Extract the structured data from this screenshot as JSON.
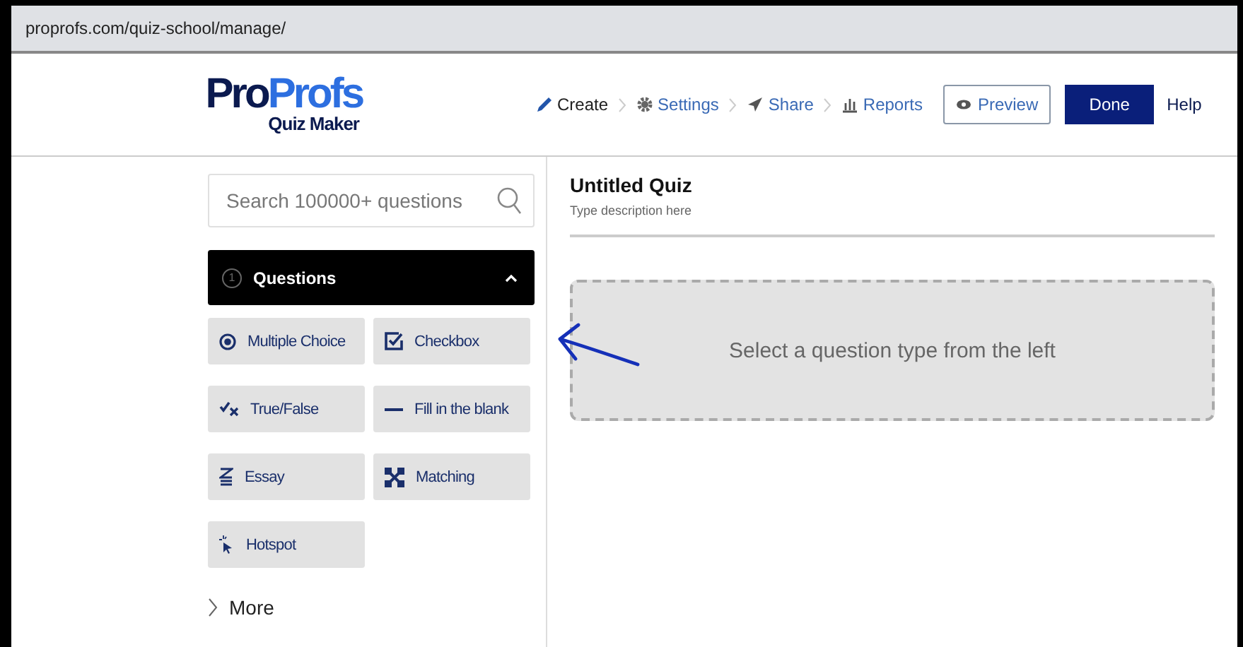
{
  "address_bar": {
    "url": "proprofs.com/quiz-school/manage/"
  },
  "header": {
    "logo": {
      "brand_dark": "Pro",
      "brand_blue": "Profs",
      "product": "Quiz Maker"
    },
    "steps": [
      {
        "kind": "pencil",
        "label": "Create"
      },
      {
        "kind": "gear",
        "label": "Settings"
      },
      {
        "kind": "plane",
        "label": "Share"
      },
      {
        "kind": "bars",
        "label": "Reports"
      }
    ],
    "preview_button": "Preview",
    "done_button": "Done",
    "help_link": "Help"
  },
  "sidebar": {
    "search": {
      "placeholder": "Search 100000+ questions"
    },
    "section": {
      "number": "1",
      "title": "Questions",
      "expanded": true
    },
    "question_types": [
      {
        "kind": "radio",
        "label": "Multiple Choice"
      },
      {
        "kind": "checkbox",
        "label": "Checkbox"
      },
      {
        "kind": "truefalse",
        "label": "True/False"
      },
      {
        "kind": "blank",
        "label": "Fill in the blank"
      },
      {
        "kind": "essay",
        "label": "Essay"
      },
      {
        "kind": "matching",
        "label": "Matching"
      },
      {
        "kind": "hotspot",
        "label": "Hotspot"
      }
    ],
    "more": "More"
  },
  "quiz": {
    "title": "Untitled Quiz",
    "description": "Type description here",
    "empty_message": "Select a question type from the left"
  }
}
